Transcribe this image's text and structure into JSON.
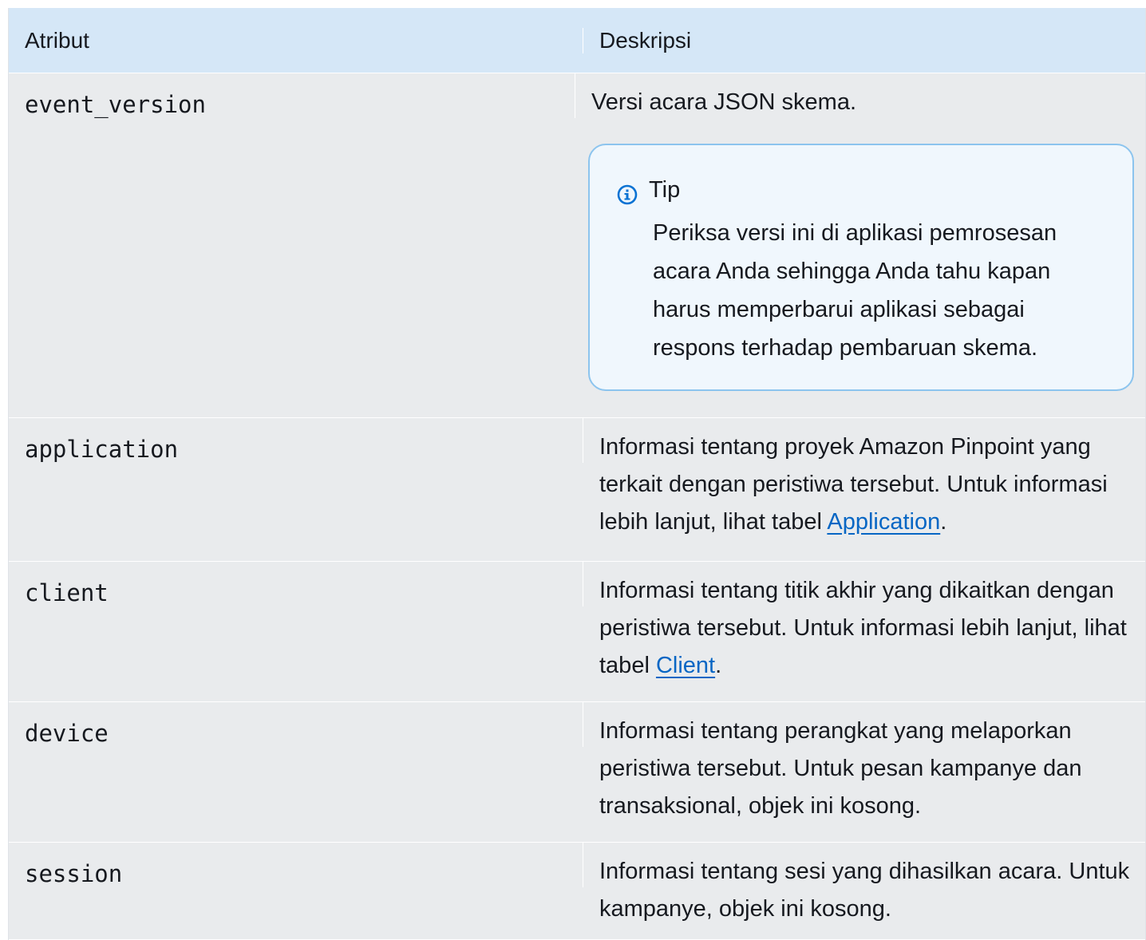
{
  "header": {
    "col1": "Atribut",
    "col2": "Deskripsi"
  },
  "rows": [
    {
      "attribute": "event_version",
      "description": "Versi acara JSON skema.",
      "tip": {
        "icon": "info-icon",
        "title": "Tip",
        "text": "Periksa versi ini di aplikasi pemrosesan acara Anda sehingga Anda tahu kapan harus memperbarui aplikasi sebagai respons terhadap pembaruan skema."
      }
    },
    {
      "attribute": "application",
      "description_before": "Informasi tentang proyek Amazon Pinpoint yang terkait dengan peristiwa tersebut. Untuk informasi lebih lanjut, lihat tabel ",
      "link": "Application",
      "description_after": "."
    },
    {
      "attribute": "client",
      "description_before": "Informasi tentang titik akhir yang dikaitkan dengan peristiwa tersebut. Untuk informasi lebih lanjut, lihat tabel ",
      "link": "Client",
      "description_after": "."
    },
    {
      "attribute": "device",
      "description": "Informasi tentang perangkat yang melaporkan peristiwa tersebut. Untuk pesan kampanye dan transaksional, objek ini kosong."
    },
    {
      "attribute": "session",
      "description": "Informasi tentang sesi yang dihasilkan acara. Untuk kampanye, objek ini kosong."
    }
  ],
  "colors": {
    "header_bg": "#d5e7f7",
    "row_bg": "#e9ebed",
    "tip_border": "#8cc4ee",
    "tip_bg": "#f0f7fd",
    "link": "#0766c4",
    "info_icon": "#0972d3"
  }
}
